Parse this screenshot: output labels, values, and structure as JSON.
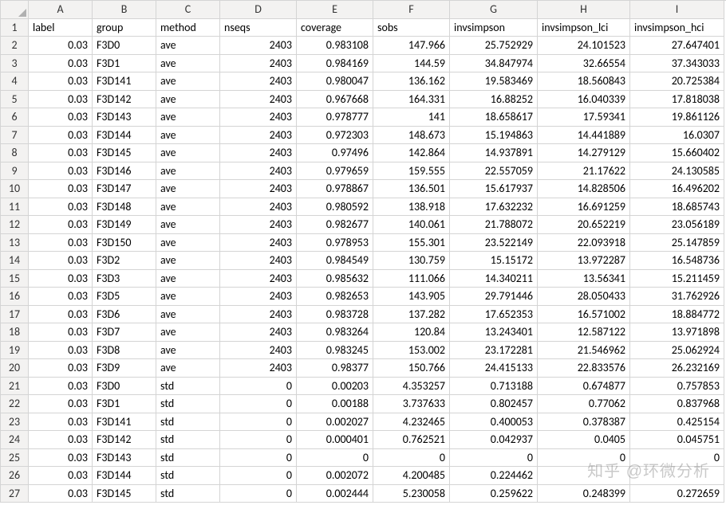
{
  "columns": [
    "A",
    "B",
    "C",
    "D",
    "E",
    "F",
    "G",
    "H",
    "I"
  ],
  "headers": [
    "label",
    "group",
    "method",
    "nseqs",
    "coverage",
    "sobs",
    "invsimpson",
    "invsimpson_lci",
    "invsimpson_hci"
  ],
  "rows": [
    {
      "label": "0.03",
      "group": "F3D0",
      "method": "ave",
      "nseqs": "2403",
      "coverage": "0.983108",
      "sobs": "147.966",
      "invsimpson": "25.752929",
      "lci": "24.101523",
      "hci": "27.647401"
    },
    {
      "label": "0.03",
      "group": "F3D1",
      "method": "ave",
      "nseqs": "2403",
      "coverage": "0.984169",
      "sobs": "144.59",
      "invsimpson": "34.847974",
      "lci": "32.66554",
      "hci": "37.343033"
    },
    {
      "label": "0.03",
      "group": "F3D141",
      "method": "ave",
      "nseqs": "2403",
      "coverage": "0.980047",
      "sobs": "136.162",
      "invsimpson": "19.583469",
      "lci": "18.560843",
      "hci": "20.725384"
    },
    {
      "label": "0.03",
      "group": "F3D142",
      "method": "ave",
      "nseqs": "2403",
      "coverage": "0.967668",
      "sobs": "164.331",
      "invsimpson": "16.88252",
      "lci": "16.040339",
      "hci": "17.818038"
    },
    {
      "label": "0.03",
      "group": "F3D143",
      "method": "ave",
      "nseqs": "2403",
      "coverage": "0.978777",
      "sobs": "141",
      "invsimpson": "18.658617",
      "lci": "17.59341",
      "hci": "19.861126"
    },
    {
      "label": "0.03",
      "group": "F3D144",
      "method": "ave",
      "nseqs": "2403",
      "coverage": "0.972303",
      "sobs": "148.673",
      "invsimpson": "15.194863",
      "lci": "14.441889",
      "hci": "16.0307"
    },
    {
      "label": "0.03",
      "group": "F3D145",
      "method": "ave",
      "nseqs": "2403",
      "coverage": "0.97496",
      "sobs": "142.864",
      "invsimpson": "14.937891",
      "lci": "14.279129",
      "hci": "15.660402"
    },
    {
      "label": "0.03",
      "group": "F3D146",
      "method": "ave",
      "nseqs": "2403",
      "coverage": "0.979659",
      "sobs": "159.555",
      "invsimpson": "22.557059",
      "lci": "21.17622",
      "hci": "24.130585"
    },
    {
      "label": "0.03",
      "group": "F3D147",
      "method": "ave",
      "nseqs": "2403",
      "coverage": "0.978867",
      "sobs": "136.501",
      "invsimpson": "15.617937",
      "lci": "14.828506",
      "hci": "16.496202"
    },
    {
      "label": "0.03",
      "group": "F3D148",
      "method": "ave",
      "nseqs": "2403",
      "coverage": "0.980592",
      "sobs": "138.918",
      "invsimpson": "17.632232",
      "lci": "16.691259",
      "hci": "18.685743"
    },
    {
      "label": "0.03",
      "group": "F3D149",
      "method": "ave",
      "nseqs": "2403",
      "coverage": "0.982677",
      "sobs": "140.061",
      "invsimpson": "21.788072",
      "lci": "20.652219",
      "hci": "23.056189"
    },
    {
      "label": "0.03",
      "group": "F3D150",
      "method": "ave",
      "nseqs": "2403",
      "coverage": "0.978953",
      "sobs": "155.301",
      "invsimpson": "23.522149",
      "lci": "22.093918",
      "hci": "25.147859"
    },
    {
      "label": "0.03",
      "group": "F3D2",
      "method": "ave",
      "nseqs": "2403",
      "coverage": "0.984549",
      "sobs": "130.759",
      "invsimpson": "15.15172",
      "lci": "13.972287",
      "hci": "16.548736"
    },
    {
      "label": "0.03",
      "group": "F3D3",
      "method": "ave",
      "nseqs": "2403",
      "coverage": "0.985632",
      "sobs": "111.066",
      "invsimpson": "14.340211",
      "lci": "13.56341",
      "hci": "15.211459"
    },
    {
      "label": "0.03",
      "group": "F3D5",
      "method": "ave",
      "nseqs": "2403",
      "coverage": "0.982653",
      "sobs": "143.905",
      "invsimpson": "29.791446",
      "lci": "28.050433",
      "hci": "31.762926"
    },
    {
      "label": "0.03",
      "group": "F3D6",
      "method": "ave",
      "nseqs": "2403",
      "coverage": "0.983728",
      "sobs": "137.282",
      "invsimpson": "17.652353",
      "lci": "16.571002",
      "hci": "18.884772"
    },
    {
      "label": "0.03",
      "group": "F3D7",
      "method": "ave",
      "nseqs": "2403",
      "coverage": "0.983264",
      "sobs": "120.84",
      "invsimpson": "13.243401",
      "lci": "12.587122",
      "hci": "13.971898"
    },
    {
      "label": "0.03",
      "group": "F3D8",
      "method": "ave",
      "nseqs": "2403",
      "coverage": "0.983245",
      "sobs": "153.002",
      "invsimpson": "23.172281",
      "lci": "21.546962",
      "hci": "25.062924"
    },
    {
      "label": "0.03",
      "group": "F3D9",
      "method": "ave",
      "nseqs": "2403",
      "coverage": "0.98377",
      "sobs": "150.766",
      "invsimpson": "24.415133",
      "lci": "22.833576",
      "hci": "26.232169"
    },
    {
      "label": "0.03",
      "group": "F3D0",
      "method": "std",
      "nseqs": "0",
      "coverage": "0.00203",
      "sobs": "4.353257",
      "invsimpson": "0.713188",
      "lci": "0.674877",
      "hci": "0.757853"
    },
    {
      "label": "0.03",
      "group": "F3D1",
      "method": "std",
      "nseqs": "0",
      "coverage": "0.00188",
      "sobs": "3.737633",
      "invsimpson": "0.802457",
      "lci": "0.77062",
      "hci": "0.837968"
    },
    {
      "label": "0.03",
      "group": "F3D141",
      "method": "std",
      "nseqs": "0",
      "coverage": "0.002027",
      "sobs": "4.232465",
      "invsimpson": "0.400053",
      "lci": "0.378387",
      "hci": "0.425154"
    },
    {
      "label": "0.03",
      "group": "F3D142",
      "method": "std",
      "nseqs": "0",
      "coverage": "0.000401",
      "sobs": "0.762521",
      "invsimpson": "0.042937",
      "lci": "0.0405",
      "hci": "0.045751"
    },
    {
      "label": "0.03",
      "group": "F3D143",
      "method": "std",
      "nseqs": "0",
      "coverage": "0",
      "sobs": "0",
      "invsimpson": "0",
      "lci": "0",
      "hci": "0"
    },
    {
      "label": "0.03",
      "group": "F3D144",
      "method": "std",
      "nseqs": "0",
      "coverage": "0.002072",
      "sobs": "4.200485",
      "invsimpson": "0.224462",
      "lci": "",
      "hci": ""
    },
    {
      "label": "0.03",
      "group": "F3D145",
      "method": "std",
      "nseqs": "0",
      "coverage": "0.002444",
      "sobs": "5.230058",
      "invsimpson": "0.259622",
      "lci": "0.248399",
      "hci": "0.272659"
    }
  ],
  "watermark": "知乎 @环微分析"
}
